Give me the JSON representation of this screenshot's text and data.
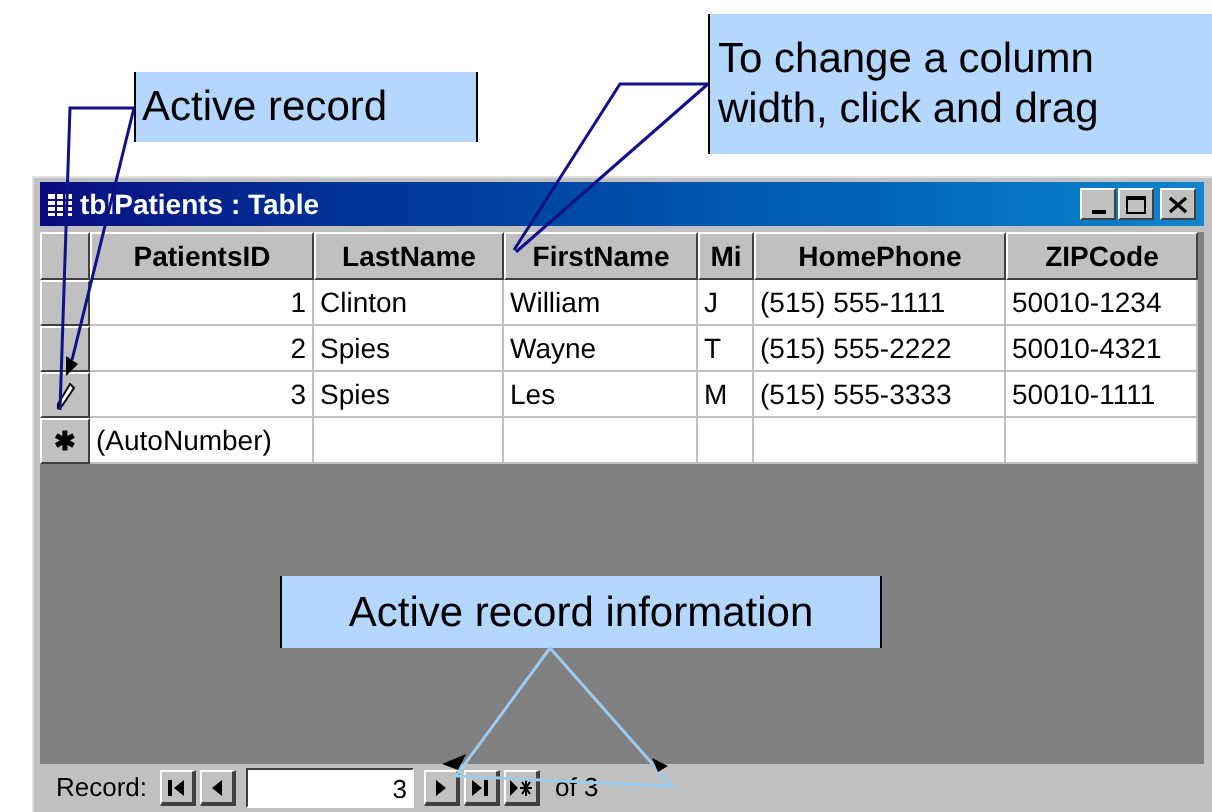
{
  "callouts": [
    {
      "text": "Active record"
    },
    {
      "text": "To change a column width, click and drag"
    },
    {
      "text": "Active record information"
    }
  ],
  "window": {
    "title": "tblPatients : Table"
  },
  "columns": [
    "PatientsID",
    "LastName",
    "FirstName",
    "Mi",
    "HomePhone",
    "ZIPCode"
  ],
  "rows": [
    {
      "editing": false,
      "cells": [
        "1",
        "Clinton",
        "William",
        "J",
        "(515) 555-1111",
        "50010-1234"
      ]
    },
    {
      "editing": false,
      "cells": [
        "2",
        "Spies",
        "Wayne",
        "T",
        "(515) 555-2222",
        "50010-4321"
      ]
    },
    {
      "editing": true,
      "cells": [
        "3",
        "Spies",
        "Les",
        "M",
        "(515) 555-3333",
        "50010-1111"
      ]
    }
  ],
  "new_row": {
    "marker": "✱",
    "value": "(AutoNumber)"
  },
  "status_bar": {
    "label": "Record:",
    "current": "3",
    "total": "of 3"
  }
}
